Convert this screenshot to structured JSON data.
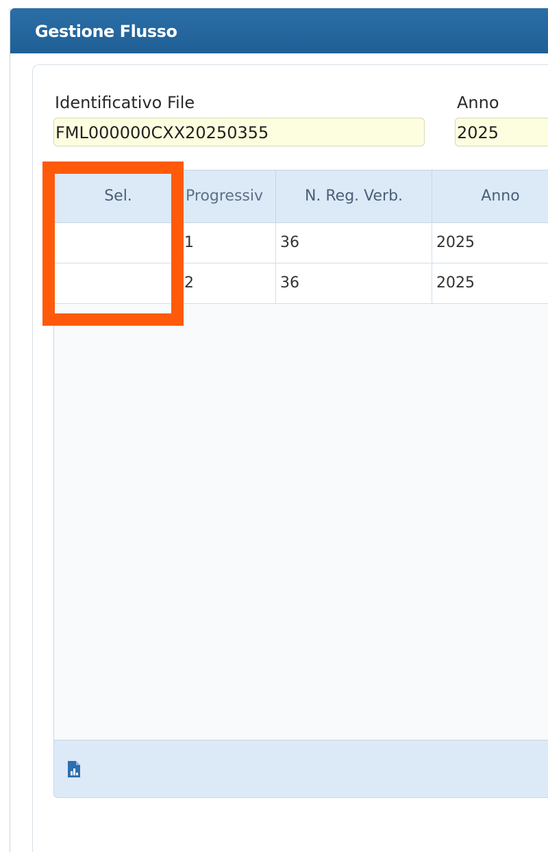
{
  "window": {
    "title": "Gestione Flusso"
  },
  "form": {
    "file_id_label": "Identificativo File",
    "file_id_value": "FML000000CXX20250355",
    "anno_label": "Anno",
    "anno_value": "2025"
  },
  "grid": {
    "columns": [
      "Sel.",
      "Progressiv",
      "N. Reg. Verb.",
      "Anno"
    ],
    "rows": [
      [
        "",
        "1",
        "36",
        "2025"
      ],
      [
        "",
        "2",
        "36",
        "2025"
      ]
    ]
  },
  "footer": {
    "icon": "report-chart-icon"
  },
  "highlight": {
    "color": "#ff5a0a",
    "target": "Sel."
  },
  "colors": {
    "titlebar": "#1f5f96",
    "field_bg": "#fdfde0",
    "grid_header": "#dce9f7"
  }
}
